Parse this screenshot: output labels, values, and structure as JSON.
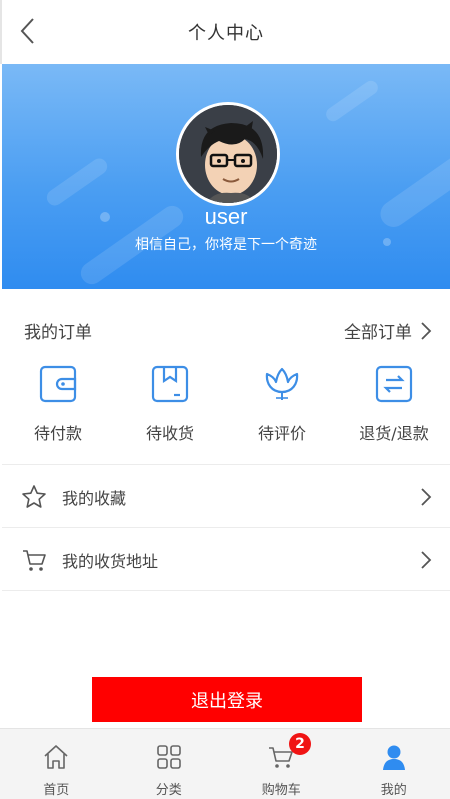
{
  "header": {
    "title": "个人中心"
  },
  "profile": {
    "username": "user",
    "motto": "相信自己，你将是下一个奇迹"
  },
  "orders": {
    "title": "我的订单",
    "all_label": "全部订单",
    "items": [
      {
        "label": "待付款",
        "icon": "wallet-icon"
      },
      {
        "label": "待收货",
        "icon": "package-icon"
      },
      {
        "label": "待评价",
        "icon": "flower-icon"
      },
      {
        "label": "退货/退款",
        "icon": "exchange-icon"
      }
    ]
  },
  "menu": [
    {
      "label": "我的收藏",
      "icon": "star-icon"
    },
    {
      "label": "我的收货地址",
      "icon": "cart-icon"
    }
  ],
  "logout": {
    "label": "退出登录"
  },
  "tabbar": {
    "items": [
      {
        "label": "首页",
        "icon": "home-icon"
      },
      {
        "label": "分类",
        "icon": "grid-icon"
      },
      {
        "label": "购物车",
        "icon": "cart-icon",
        "badge": "2"
      },
      {
        "label": "我的",
        "icon": "user-icon",
        "active": true
      }
    ]
  },
  "colors": {
    "accent": "#2f8cf0",
    "icon_blue": "#3d8ee6",
    "logout": "#ff0000",
    "badge": "#f01414"
  }
}
